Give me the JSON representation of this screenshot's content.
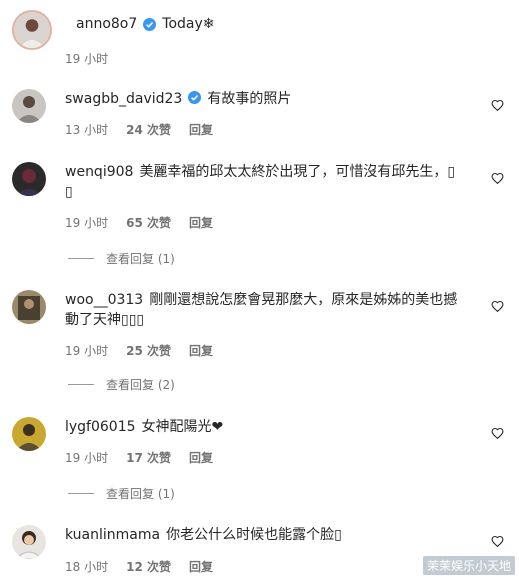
{
  "post": {
    "username": "anno8o7",
    "caption": "Today❄",
    "time": "19 小时"
  },
  "comments": [
    {
      "username": "swagbb_david23",
      "verified": true,
      "text": "有故事的照片",
      "time": "13 小时",
      "likes": "24 次赞",
      "reply": "回复",
      "view_replies": ""
    },
    {
      "username": "wenqi908",
      "verified": false,
      "text": "美麗幸福的邱太太終於出現了，可惜沒有邱先生，▯",
      "text_line2": "▯",
      "time": "19 小时",
      "likes": "65 次赞",
      "reply": "回复",
      "view_replies": "查看回复 (1)"
    },
    {
      "username": "woo__0313",
      "verified": false,
      "text": "剛剛還想說怎麼會晃那麼大，原來是姊姊的美也撼",
      "text_line2": "動了天神▯▯▯",
      "time": "19 小时",
      "likes": "25 次赞",
      "reply": "回复",
      "view_replies": "查看回复 (2)"
    },
    {
      "username": "lygf06015",
      "verified": false,
      "text": "女神配陽光❤",
      "time": "19 小时",
      "likes": "17 次赞",
      "reply": "回复",
      "view_replies": "查看回复 (1)"
    },
    {
      "username": "kuanlinmama",
      "verified": false,
      "text": "你老公什么时候也能露个脸▯",
      "time": "18 小时",
      "likes": "12 次赞",
      "reply": "回复",
      "view_replies": ""
    }
  ],
  "watermark": "茉茉娱乐小天地",
  "colors": {
    "verified": "#3897f0",
    "meta": "#737373",
    "text": "#262626"
  }
}
